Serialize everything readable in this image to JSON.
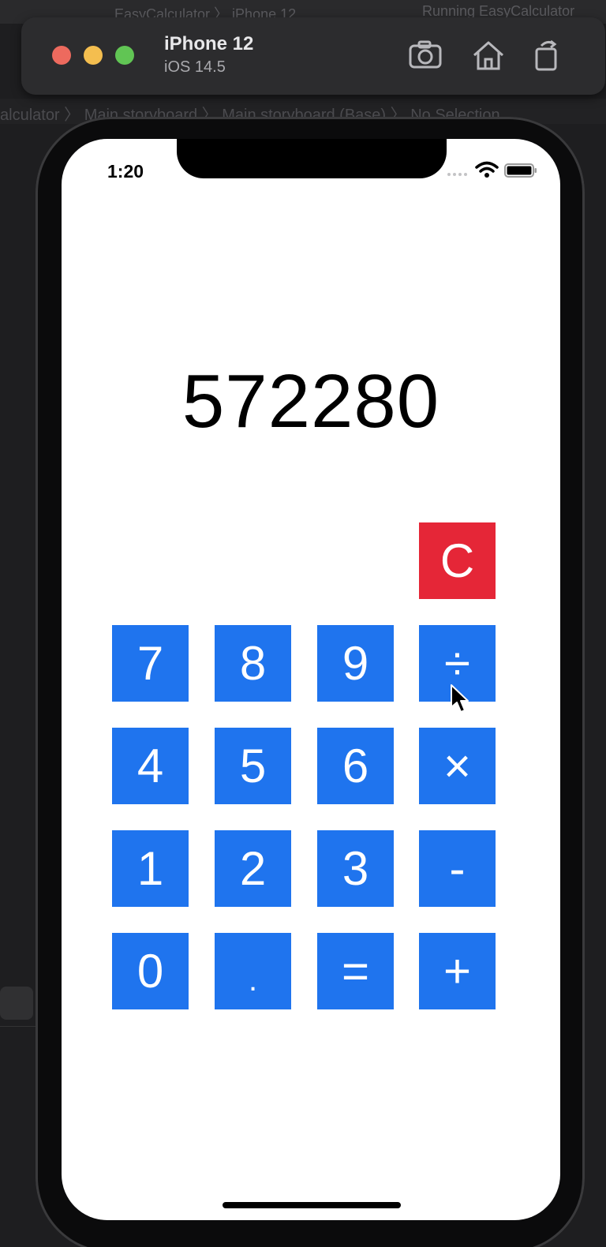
{
  "xcode": {
    "tab_text": "EasyCalculator 〉 iPhone 12",
    "status_text": "Running EasyCalculator",
    "breadcrumb_text": "alculator 〉 Main.storyboard 〉 Main.storyboard (Base) 〉 No Selection"
  },
  "simulator": {
    "device_name": "iPhone 12",
    "os_version": "iOS 14.5",
    "toolbar_icons": [
      "camera-screenshot-icon",
      "home-icon",
      "rotate-icon"
    ]
  },
  "status_bar": {
    "time": "1:20"
  },
  "calculator": {
    "display_value": "572280",
    "clear_label": "C",
    "keys": [
      [
        "7",
        "8",
        "9",
        "÷"
      ],
      [
        "4",
        "5",
        "6",
        "×"
      ],
      [
        "1",
        "2",
        "3",
        "-"
      ],
      [
        "0",
        ".",
        "=",
        "+"
      ]
    ]
  },
  "colors": {
    "key_blue": "#1f74ee",
    "clear_red": "#e52637",
    "screen_bg": "#ffffff"
  }
}
